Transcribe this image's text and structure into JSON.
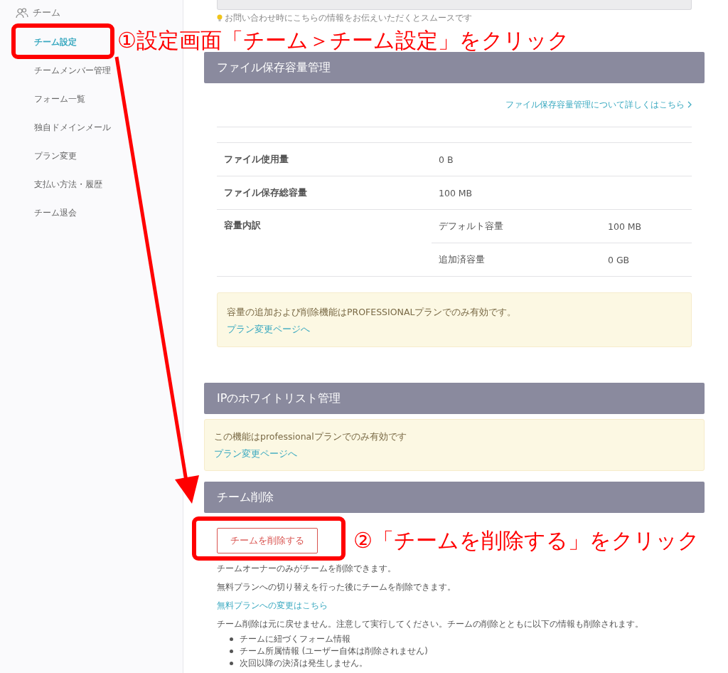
{
  "sidebar": {
    "group": "チーム",
    "items": [
      {
        "label": "チーム設定",
        "selected": true
      },
      {
        "label": "チームメンバー管理",
        "selected": false
      },
      {
        "label": "フォーム一覧",
        "selected": false
      },
      {
        "label": "独自ドメインメール",
        "selected": false
      },
      {
        "label": "プラン変更",
        "selected": false
      },
      {
        "label": "支払い方法・履歴",
        "selected": false
      },
      {
        "label": "チーム退会",
        "selected": false
      }
    ]
  },
  "contact_hint": "お問い合わせ時にこちらの情報をお伝えいただくとスムースです",
  "storage": {
    "title": "ファイル保存容量管理",
    "help_link": "ファイル保存容量管理について詳しくはこちら",
    "rows": [
      {
        "label": "ファイル使用量",
        "value": "0 B"
      },
      {
        "label": "ファイル保存総容量",
        "value": "100 MB"
      },
      {
        "label": "容量内訳",
        "breakdown": [
          {
            "label": "デフォルト容量",
            "value": "100 MB"
          },
          {
            "label": "追加済容量",
            "value": "0 GB"
          }
        ]
      }
    ],
    "notice": {
      "text": "容量の追加および削除機能はPROFESSIONALプランでのみ有効です。",
      "link": "プラン変更ページへ"
    }
  },
  "ip_whitelist": {
    "title": "IPのホワイトリスト管理",
    "notice": {
      "text": "この機能はprofessionalプランでのみ有効です",
      "link": "プラン変更ページへ"
    }
  },
  "team_delete": {
    "title": "チーム削除",
    "button": "チームを削除する",
    "notes": [
      "チームオーナーのみがチームを削除できます。",
      "無料プランへの切り替えを行った後にチームを削除できます。"
    ],
    "link": "無料プランへの変更はこちら",
    "warning": "チーム削除は元に戻せません。注意して実行してください。チームの削除とともに以下の情報も削除されます。",
    "items": [
      "チームに紐づくフォーム情報",
      "チーム所属情報 (ユーザー自体は削除されません)",
      "次回以降の決済は発生しません。"
    ]
  },
  "annotations": [
    {
      "text": "①設定画面「チーム＞チーム設定」をクリック"
    },
    {
      "text": "②「チームを削除する」をクリック"
    }
  ]
}
